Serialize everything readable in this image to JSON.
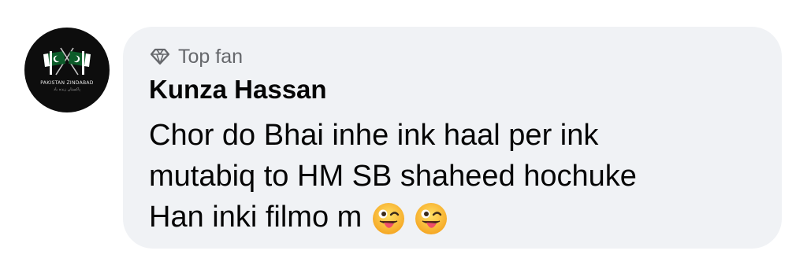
{
  "avatar": {
    "text_main": "PAKISTAN ZINDABAD",
    "text_sub": "پاکستان زندہ باد"
  },
  "comment": {
    "badge": {
      "icon": "diamond-icon",
      "label": "Top fan"
    },
    "author": "Kunza Hassan",
    "lines": [
      "Chor do Bhai inhe ink haal per ink",
      "mutabiq to HM SB shaheed hochuke",
      "Han inki filmo m"
    ],
    "emojis": [
      "winking-face-with-tongue",
      "winking-face-with-tongue"
    ]
  },
  "colors": {
    "bubble_bg": "#f0f2f5",
    "secondary_text": "#65676b",
    "primary_text": "#050505"
  }
}
